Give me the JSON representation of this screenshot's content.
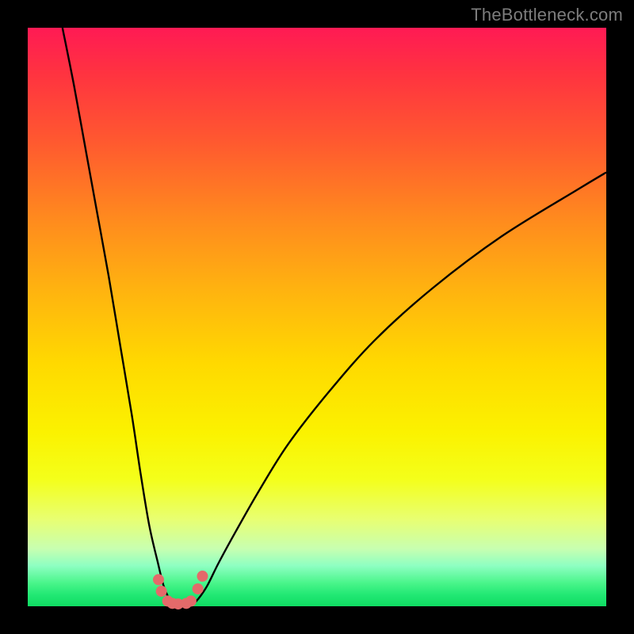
{
  "watermark": "TheBottleneck.com",
  "chart_data": {
    "type": "line",
    "title": "",
    "xlabel": "",
    "ylabel": "",
    "xlim": [
      0,
      100
    ],
    "ylim": [
      0,
      100
    ],
    "series": [
      {
        "name": "left-branch",
        "x": [
          6,
          8,
          10,
          12,
          14,
          16,
          18,
          19.5,
          21,
          22.5,
          23.5,
          24.5,
          25.2
        ],
        "y": [
          100,
          90,
          79,
          68,
          57,
          45,
          33,
          23,
          14,
          7.5,
          3.5,
          1.2,
          0.3
        ]
      },
      {
        "name": "right-branch",
        "x": [
          28.5,
          29.5,
          31,
          33,
          36,
          40,
          45,
          52,
          60,
          70,
          82,
          95,
          100
        ],
        "y": [
          0.3,
          1.3,
          3.5,
          7.5,
          13,
          20,
          28,
          37,
          46,
          55,
          64,
          72,
          75
        ]
      }
    ],
    "floor_markers": {
      "name": "near-floor-dots",
      "color": "#e46a6a",
      "x": [
        22.6,
        23.1,
        24.2,
        25.0,
        26.0,
        27.4,
        28.2,
        29.4,
        30.2
      ],
      "y": [
        4.6,
        2.6,
        0.9,
        0.5,
        0.4,
        0.5,
        0.9,
        3.0,
        5.2
      ]
    },
    "green_floor_band": {
      "y_from": 0,
      "y_to": 2.2
    }
  }
}
